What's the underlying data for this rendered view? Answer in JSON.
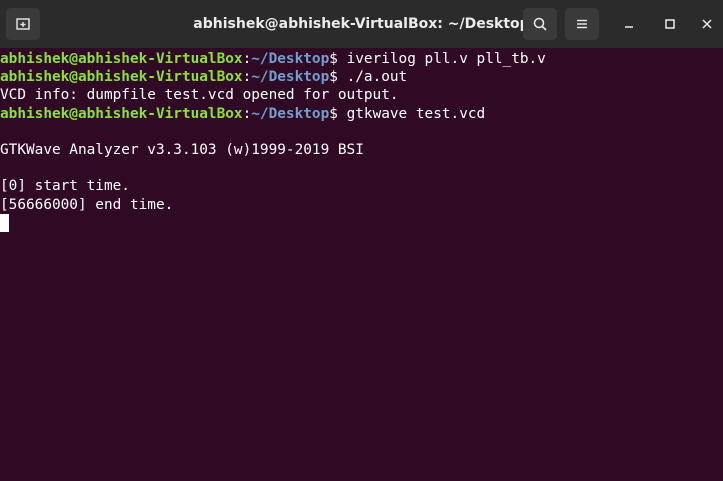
{
  "window": {
    "title": "abhishek@abhishek-VirtualBox: ~/Desktop"
  },
  "titlebar": {
    "new_tab_icon": "new-tab-icon",
    "search_icon": "search-icon",
    "menu_icon": "hamburger-menu-icon",
    "minimize_icon": "minimize-icon",
    "maximize_icon": "maximize-icon",
    "close_icon": "close-icon"
  },
  "colors": {
    "terminal_bg": "#300a24",
    "titlebar_bg": "#2b2b2b",
    "prompt_user": "#8ae234",
    "prompt_path": "#729fcf",
    "text": "#ffffff"
  },
  "terminal": {
    "lines": [
      {
        "user": "abhishek@abhishek-VirtualBox",
        "sep": ":",
        "path": "~/Desktop",
        "cmd": "$ iverilog pll.v pll_tb.v"
      },
      {
        "user": "abhishek@abhishek-VirtualBox",
        "sep": ":",
        "path": "~/Desktop",
        "cmd": "$ ./a.out"
      },
      {
        "text": "VCD info: dumpfile test.vcd opened for output."
      },
      {
        "user": "abhishek@abhishek-VirtualBox",
        "sep": ":",
        "path": "~/Desktop",
        "cmd": "$ gtkwave test.vcd"
      },
      {
        "text": ""
      },
      {
        "text": "GTKWave Analyzer v3.3.103 (w)1999-2019 BSI"
      },
      {
        "text": ""
      },
      {
        "text": "[0] start time."
      },
      {
        "text": "[56666000] end time."
      }
    ]
  }
}
